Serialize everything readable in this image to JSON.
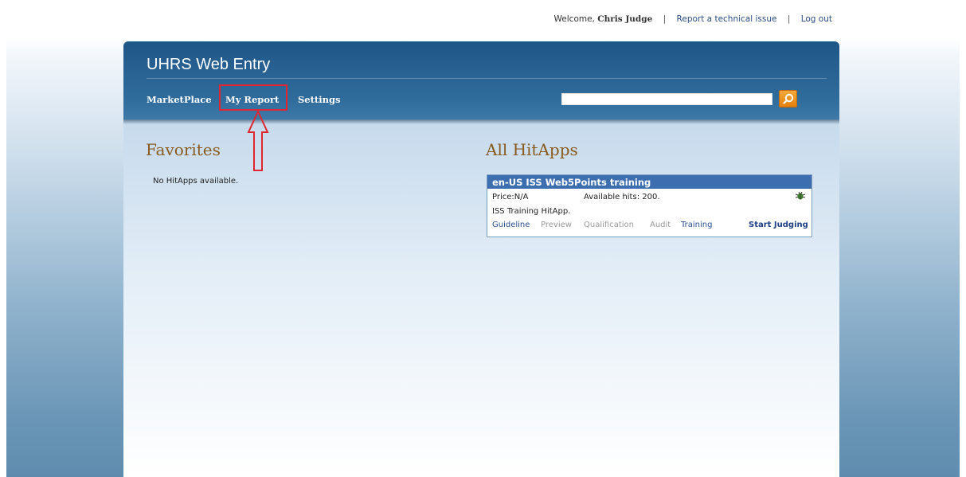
{
  "topbar": {
    "welcome_prefix": "Welcome,",
    "user_name": "Chris Judge",
    "separator": "|",
    "report_issue": "Report a technical issue",
    "logout": "Log out"
  },
  "header": {
    "app_title": "UHRS Web Entry",
    "nav": {
      "marketplace": "MarketPlace",
      "my_report": "My Report",
      "settings": "Settings"
    },
    "search": {
      "value": "",
      "placeholder": ""
    }
  },
  "favorites": {
    "title": "Favorites",
    "empty_message": "No HitApps available."
  },
  "all_hitapps": {
    "title": "All HitApps",
    "card": {
      "name": "en-US ISS Web5Points training",
      "price": "Price:N/A",
      "available": "Available hits: 200.",
      "description": "ISS Training HitApp.",
      "links": {
        "guideline": "Guideline",
        "preview": "Preview",
        "qualification": "Qualification",
        "audit": "Audit",
        "training": "Training",
        "start": "Start Judging"
      }
    }
  },
  "colors": {
    "header_blue": "#2a6494",
    "highlight_red": "#e0262f",
    "section_title": "#8a5a1e",
    "card_header": "#3d6fb0",
    "search_button": "#f0a030"
  },
  "icons": {
    "search": "magnifier-icon",
    "bug": "bug-icon",
    "annotation_arrow": "up-arrow-icon"
  }
}
